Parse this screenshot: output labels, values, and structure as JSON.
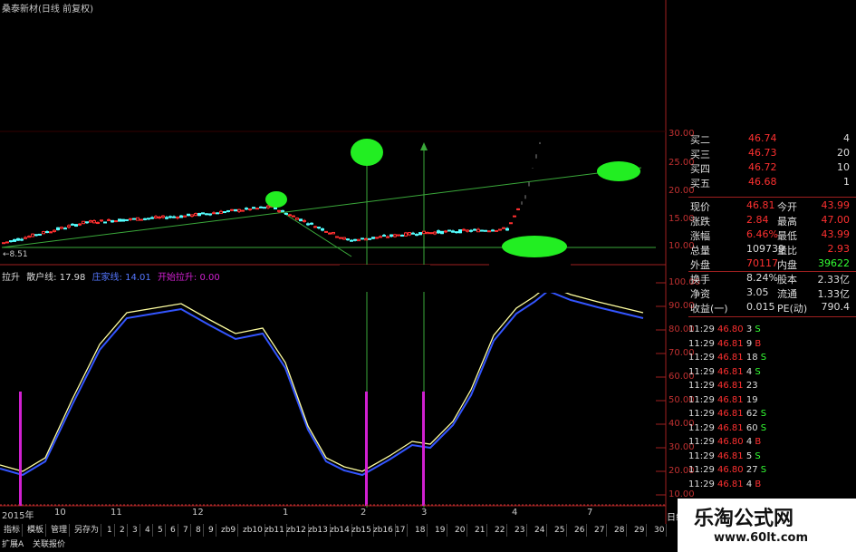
{
  "title": "桑泰新材(日线 前复权)",
  "price_axis_labels": [
    "30.00",
    "25.00",
    "20.00",
    "15.00",
    "10.00"
  ],
  "low_label": "8.51",
  "indicator_labels": {
    "name": "拉升",
    "retail": "散户线: 17.98",
    "dealer": "庄家线: 14.01",
    "start": "开始拉升: 0.00"
  },
  "indicator_axis_labels": [
    "100.00",
    "90.00",
    "80.00",
    "70.00",
    "60.00",
    "50.00",
    "40.00",
    "30.00",
    "20.00",
    "10.00"
  ],
  "date_axis": [
    "2015年",
    "10",
    "11",
    "12",
    "1",
    "2",
    "3",
    "4",
    "7"
  ],
  "quote_top": [
    {
      "label": "买二",
      "price": "46.74",
      "vol": "4"
    },
    {
      "label": "买三",
      "price": "46.73",
      "vol": "20"
    },
    {
      "label": "买四",
      "price": "46.72",
      "vol": "10"
    },
    {
      "label": "买五",
      "price": "46.68",
      "vol": "1"
    }
  ],
  "quote_stats": [
    {
      "l1": "现价",
      "v1": "46.81",
      "l2": "今开",
      "v2": "43.99"
    },
    {
      "l1": "涨跌",
      "v1": "2.84",
      "l2": "最高",
      "v2": "47.00"
    },
    {
      "l1": "涨幅",
      "v1": "6.46%",
      "l2": "最低",
      "v2": "43.99"
    },
    {
      "l1": "总量",
      "v1": "109739",
      "l2": "量比",
      "v2": "2.93"
    },
    {
      "l1": "外盘",
      "v1": "70117",
      "l2": "内盘",
      "v2": "39622"
    },
    {
      "l1": "换手",
      "v1": "8.24%",
      "l2": "股本",
      "v2": "2.33亿"
    },
    {
      "l1": "净资",
      "v1": "3.05",
      "l2": "流通",
      "v2": "1.33亿"
    },
    {
      "l1": "收益(一)",
      "v1": "0.015",
      "l2": "PE(动)",
      "v2": "790.4"
    }
  ],
  "ticks": [
    {
      "t": "11:29",
      "p": "46.80",
      "v": "3",
      "s": "S"
    },
    {
      "t": "11:29",
      "p": "46.81",
      "v": "9",
      "s": "B"
    },
    {
      "t": "11:29",
      "p": "46.81",
      "v": "18",
      "s": "S"
    },
    {
      "t": "11:29",
      "p": "46.81",
      "v": "4",
      "s": "S"
    },
    {
      "t": "11:29",
      "p": "46.81",
      "v": "23",
      "s": ""
    },
    {
      "t": "11:29",
      "p": "46.81",
      "v": "19",
      "s": ""
    },
    {
      "t": "11:29",
      "p": "46.81",
      "v": "62",
      "s": "S"
    },
    {
      "t": "11:29",
      "p": "46.81",
      "v": "60",
      "s": "S"
    },
    {
      "t": "11:29",
      "p": "46.80",
      "v": "4",
      "s": "B"
    },
    {
      "t": "11:29",
      "p": "46.81",
      "v": "5",
      "s": "S"
    },
    {
      "t": "11:29",
      "p": "46.80",
      "v": "27",
      "s": "S"
    },
    {
      "t": "11:29",
      "p": "46.81",
      "v": "4",
      "s": "B"
    }
  ],
  "tabs": [
    "指标",
    "模板",
    "管理",
    "另存为",
    "1",
    "2",
    "3",
    "4",
    "5",
    "6",
    "7",
    "8",
    "9",
    "zb9",
    "zb10",
    "zb11",
    "zb12",
    "zb13",
    "zb14",
    "zb15",
    "zb16",
    "17",
    "18",
    "19",
    "20",
    "21",
    "22",
    "23",
    "24",
    "25",
    "26",
    "27",
    "28",
    "29",
    "30"
  ],
  "bottom_tabs": [
    "扩展A",
    "关联报价"
  ],
  "side_tab": "日线",
  "watermark": {
    "line1": "乐淘公式网",
    "line2": "www.60lt.com"
  },
  "colors": {
    "axis": "#c03030",
    "retail_line": "#3355ff",
    "dealer_line": "#ffffa0",
    "signal": "#d020d0",
    "trend": "#3aa83a",
    "highlight": "#22ee22",
    "price_up": "#ff3030",
    "price_down": "#33ff33"
  }
}
